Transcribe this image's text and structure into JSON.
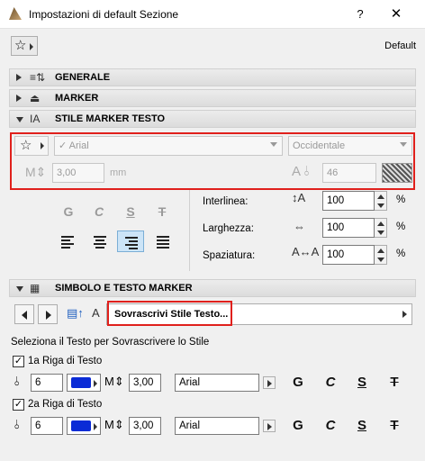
{
  "window": {
    "title": "Impostazioni di default Sezione",
    "help": "?",
    "close": "✕"
  },
  "favorites": {
    "icon": "☆",
    "default_label": "Default"
  },
  "sections": {
    "generale": "GENERALE",
    "marker": "MARKER",
    "stile": "STILE MARKER TESTO",
    "simbolo": "SIMBOLO E TESTO MARKER"
  },
  "text_style": {
    "font": "Arial",
    "script": "Occidentale",
    "size": "3,00",
    "size_unit": "mm",
    "pen": "46",
    "format_bold": "G",
    "format_italic": "C",
    "format_underline": "S",
    "format_strike": "T"
  },
  "spacing": {
    "interlinea_label": "Interlinea:",
    "interlinea_value": "100",
    "larghezza_label": "Larghezza:",
    "larghezza_value": "100",
    "spaziatura_label": "Spaziatura:",
    "spaziatura_value": "100",
    "unit": "%"
  },
  "override": {
    "dropdown": "Sovrascrivi Stile Testo...",
    "instruction": "Seleziona il Testo per Sovrascrivere lo Stile"
  },
  "rows": [
    {
      "label": "1a Riga di Testo",
      "checked": true,
      "pen": "6",
      "size": "3,00",
      "font": "Arial"
    },
    {
      "label": "2a Riga di Testo",
      "checked": true,
      "pen": "6",
      "size": "3,00",
      "font": "Arial"
    }
  ],
  "fmt": {
    "bold": "G",
    "italic": "C",
    "underline": "S",
    "strike": "T"
  },
  "colors": {
    "highlight": "#e0201c",
    "pen_swatch": "#0a2bd6",
    "selected_align": "#cce4f7"
  }
}
